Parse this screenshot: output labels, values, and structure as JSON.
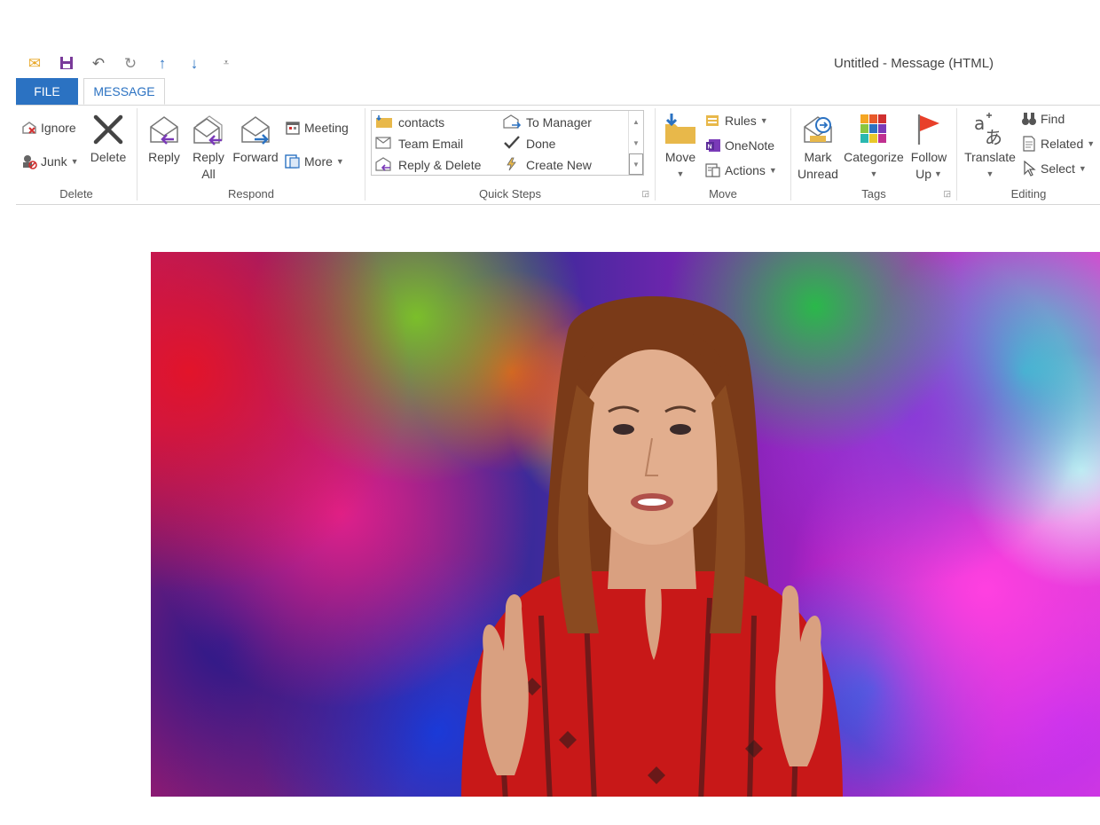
{
  "window": {
    "title": "Untitled - Message (HTML)"
  },
  "quick_access": {
    "icons": [
      "envelope-icon",
      "save-icon",
      "undo-icon",
      "redo-icon",
      "up-arrow-icon",
      "down-arrow-icon",
      "customize-icon"
    ]
  },
  "tabs": {
    "file": "FILE",
    "message": "MESSAGE"
  },
  "ribbon": {
    "delete_group": {
      "label": "Delete",
      "ignore": "Ignore",
      "junk": "Junk",
      "delete": "Delete"
    },
    "respond_group": {
      "label": "Respond",
      "reply": "Reply",
      "reply_all_line1": "Reply",
      "reply_all_line2": "All",
      "forward": "Forward",
      "meeting": "Meeting",
      "more": "More"
    },
    "quick_steps_group": {
      "label": "Quick Steps",
      "items": [
        "contacts",
        "To Manager",
        "Team Email",
        "Done",
        "Reply & Delete",
        "Create New"
      ]
    },
    "move_group": {
      "label": "Move",
      "move": "Move",
      "rules": "Rules",
      "onenote": "OneNote",
      "actions": "Actions"
    },
    "tags_group": {
      "label": "Tags",
      "mark_unread_line1": "Mark",
      "mark_unread_line2": "Unread",
      "categorize": "Categorize",
      "follow_up_line1": "Follow",
      "follow_up_line2": "Up"
    },
    "editing_group": {
      "label": "Editing",
      "translate": "Translate",
      "find": "Find",
      "related": "Related",
      "select": "Select"
    }
  },
  "colors": {
    "accent": "#2b72c2",
    "flag": "#e8402a",
    "move_arrow": "#2b72c2"
  }
}
